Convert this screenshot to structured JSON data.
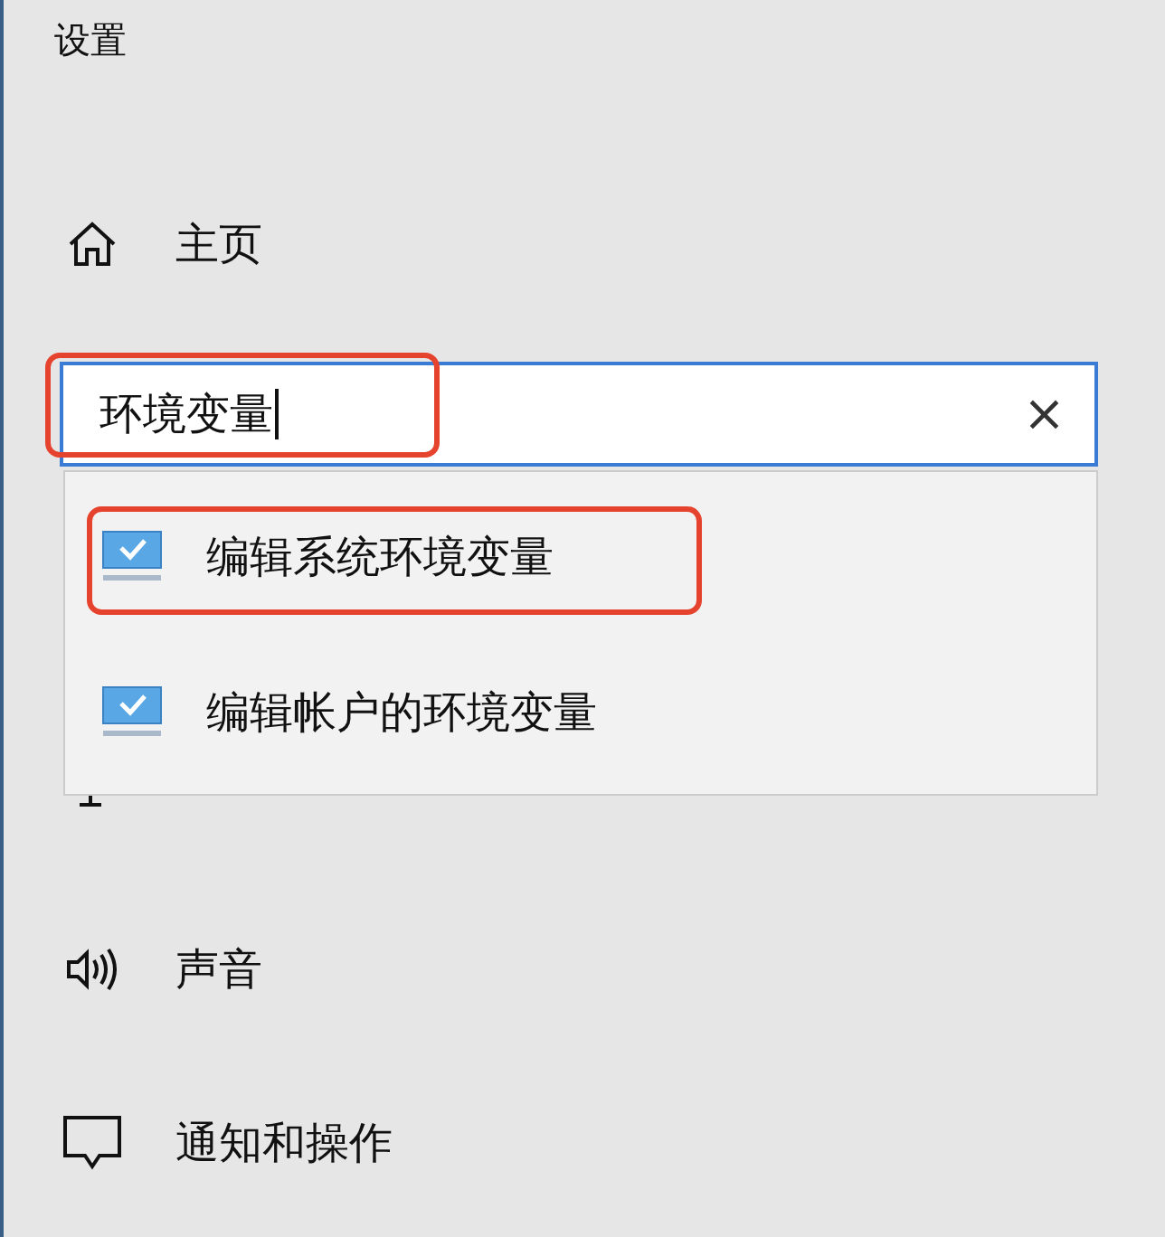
{
  "window": {
    "title": "设置"
  },
  "nav_top": {
    "kind": "home",
    "label": "主页"
  },
  "search": {
    "value": "环境变量",
    "focused": true,
    "highlighted": true,
    "clear": "×"
  },
  "suggestions": [
    {
      "label": "编辑系统环境变量",
      "highlighted": true
    },
    {
      "label": "编辑帐户的环境变量",
      "highlighted": false
    }
  ],
  "nav": [
    {
      "kind": "display"
    },
    {
      "kind": "sound",
      "label": "声音"
    },
    {
      "kind": "notification",
      "label": "通知和操作"
    }
  ]
}
